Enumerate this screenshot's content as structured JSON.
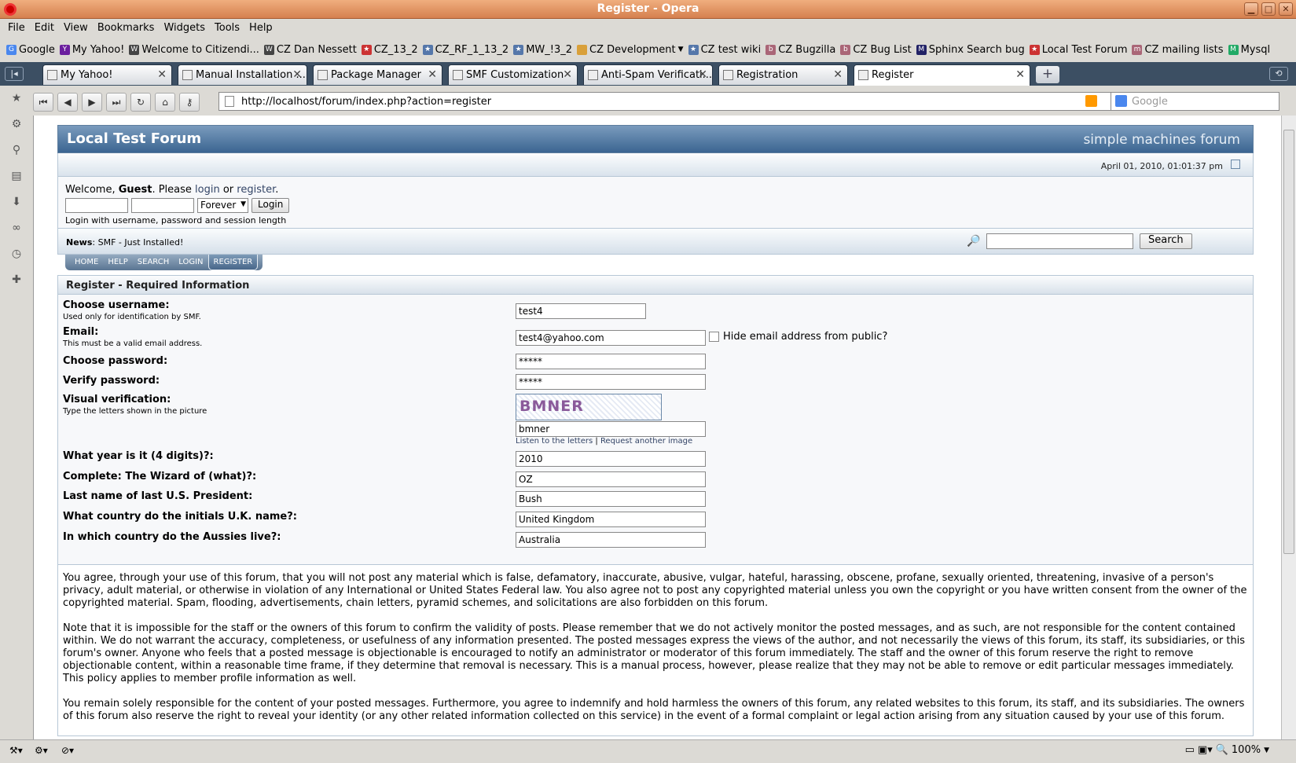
{
  "window": {
    "title": "Register - Opera"
  },
  "menubar": [
    "File",
    "Edit",
    "View",
    "Bookmarks",
    "Widgets",
    "Tools",
    "Help"
  ],
  "bookmarks": [
    {
      "label": "Google",
      "color": "#4a87ee"
    },
    {
      "label": "My Yahoo!",
      "color": "#6b1f9e"
    },
    {
      "label": "Welcome to Citizendi...",
      "color": "#444"
    },
    {
      "label": "CZ Dan Nessett",
      "color": "#444"
    },
    {
      "label": "CZ_13_2",
      "color": "#c33"
    },
    {
      "label": "CZ_RF_1_13_2",
      "color": "#5577aa"
    },
    {
      "label": "MW_!3_2",
      "color": "#5577aa"
    },
    {
      "label": "CZ Development",
      "color": "#d9a03a"
    },
    {
      "label": "CZ test wiki",
      "color": "#5577aa"
    },
    {
      "label": "CZ Bugzilla",
      "color": "#a67"
    },
    {
      "label": "CZ Bug List",
      "color": "#a67"
    },
    {
      "label": "Sphinx Search bug",
      "color": "#226"
    },
    {
      "label": "Local Test Forum",
      "color": "#c33"
    },
    {
      "label": "CZ mailing lists",
      "color": "#a67"
    },
    {
      "label": "Mysql",
      "color": "#2a6"
    }
  ],
  "tabs": [
    {
      "label": "My Yahoo!"
    },
    {
      "label": "Manual Installation ..."
    },
    {
      "label": "Package Manager"
    },
    {
      "label": "SMF Customization"
    },
    {
      "label": "Anti-Spam Verificati..."
    },
    {
      "label": "Registration"
    },
    {
      "label": "Register"
    }
  ],
  "address": {
    "url": "http://localhost/forum/index.php?action=register",
    "search_placeholder": "Google"
  },
  "status": {
    "zoom": "100%"
  },
  "forum": {
    "name": "Local Test Forum",
    "brand": "simple machines forum",
    "date": "April 01, 2010, 01:01:37 pm",
    "welcome_prefix": "Welcome, ",
    "guest": "Guest",
    "please": ". Please ",
    "login_link": "login",
    "or": " or ",
    "register_link": "register",
    "period": ".",
    "session_option": "Forever",
    "login_button": "Login",
    "login_hint": "Login with username, password and session length",
    "news_label": "News",
    "news_text": ": SMF - Just Installed!",
    "search_button": "Search",
    "menu": [
      "HOME",
      "HELP",
      "SEARCH",
      "LOGIN",
      "REGISTER"
    ]
  },
  "register": {
    "title": "Register - Required Information",
    "username_label": "Choose username:",
    "username_sub": "Used only for identification by SMF.",
    "username_value": "test4",
    "email_label": "Email:",
    "email_sub": "This must be a valid email address.",
    "email_value": "test4@yahoo.com",
    "hide_email": "Hide email address from public?",
    "password_label": "Choose password:",
    "password_value": "*****",
    "verify_label": "Verify password:",
    "verify_value": "*****",
    "visual_label": "Visual verification:",
    "visual_sub": "Type the letters shown in the picture",
    "captcha_text": "BMNER",
    "captcha_value": "bmner",
    "listen_link": "Listen to the letters",
    "sep": " | ",
    "request_link": "Request another image",
    "q1_label": "What year is it (4 digits)?:",
    "q1_value": "2010",
    "q2_label": "Complete: The Wizard of (what)?:",
    "q2_value": "OZ",
    "q3_label": "Last name of last U.S. President:",
    "q3_value": "Bush",
    "q4_label": "What country do the initials U.K. name?:",
    "q4_value": "United Kingdom",
    "q5_label": "In which country do the Aussies live?:",
    "q5_value": "Australia"
  },
  "agreement": [
    "You agree, through your use of this forum, that you will not post any material which is false, defamatory, inaccurate, abusive, vulgar, hateful, harassing, obscene, profane, sexually oriented, threatening, invasive of a person's privacy, adult material, or otherwise in violation of any International or United States Federal law. You also agree not to post any copyrighted material unless you own the copyright or you have written consent from the owner of the copyrighted material. Spam, flooding, advertisements, chain letters, pyramid schemes, and solicitations are also forbidden on this forum.",
    "Note that it is impossible for the staff or the owners of this forum to confirm the validity of posts. Please remember that we do not actively monitor the posted messages, and as such, are not responsible for the content contained within. We do not warrant the accuracy, completeness, or usefulness of any information presented. The posted messages express the views of the author, and not necessarily the views of this forum, its staff, its subsidiaries, or this forum's owner. Anyone who feels that a posted message is objectionable is encouraged to notify an administrator or moderator of this forum immediately. The staff and the owner of this forum reserve the right to remove objectionable content, within a reasonable time frame, if they determine that removal is necessary. This is a manual process, however, please realize that they may not be able to remove or edit particular messages immediately. This policy applies to member profile information as well.",
    "You remain solely responsible for the content of your posted messages. Furthermore, you agree to indemnify and hold harmless the owners of this forum, any related websites to this forum, its staff, and its subsidiaries. The owners of this forum also reserve the right to reveal your identity (or any other related information collected on this service) in the event of a formal complaint or legal action arising from any situation caused by your use of this forum."
  ]
}
